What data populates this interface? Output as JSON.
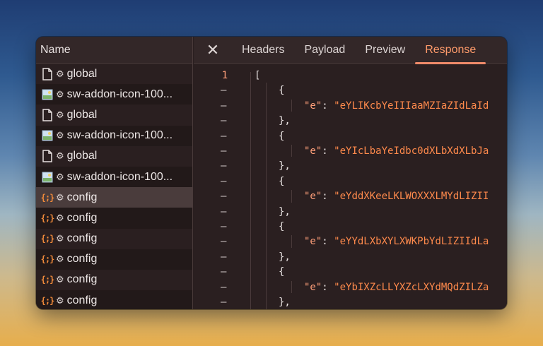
{
  "file_list": {
    "header": "Name",
    "rows": [
      {
        "icon": "document-icon",
        "name": "global"
      },
      {
        "icon": "image-icon",
        "name": "sw-addon-icon-100..."
      },
      {
        "icon": "document-icon",
        "name": "global"
      },
      {
        "icon": "image-icon",
        "name": "sw-addon-icon-100..."
      },
      {
        "icon": "document-icon",
        "name": "global"
      },
      {
        "icon": "image-icon",
        "name": "sw-addon-icon-100..."
      },
      {
        "icon": "json-icon",
        "name": "config",
        "selected": true
      },
      {
        "icon": "json-icon",
        "name": "config"
      },
      {
        "icon": "json-icon",
        "name": "config"
      },
      {
        "icon": "json-icon",
        "name": "config"
      },
      {
        "icon": "json-icon",
        "name": "config"
      },
      {
        "icon": "json-icon",
        "name": "config"
      }
    ]
  },
  "tabs": {
    "close": "✕",
    "items": [
      "Headers",
      "Payload",
      "Preview",
      "Response"
    ],
    "active": "Response"
  },
  "response": {
    "first_line_number": "1",
    "fold_marker": "–",
    "open_bracket": "[",
    "open_brace": "{",
    "close_brace": "},",
    "key": "\"e\"",
    "colon": ": ",
    "values": [
      "\"eYLIKcbYeIIIaaMZIaZIdLaId",
      "\"eYIcLbaYeIdbc0dXLbXdXLbJa",
      "\"eYddXKeeLKLWOXXXLMYdLIZII",
      "\"eYYdLXbXYLXWKPbYdLIZIIdLa",
      "\"eYbIXZcLLYXZcLXYdMQdZILZa"
    ]
  },
  "colors": {
    "accent": "#f08a6a",
    "string": "#ff8a4c",
    "json_icon": "#f08a3a"
  }
}
